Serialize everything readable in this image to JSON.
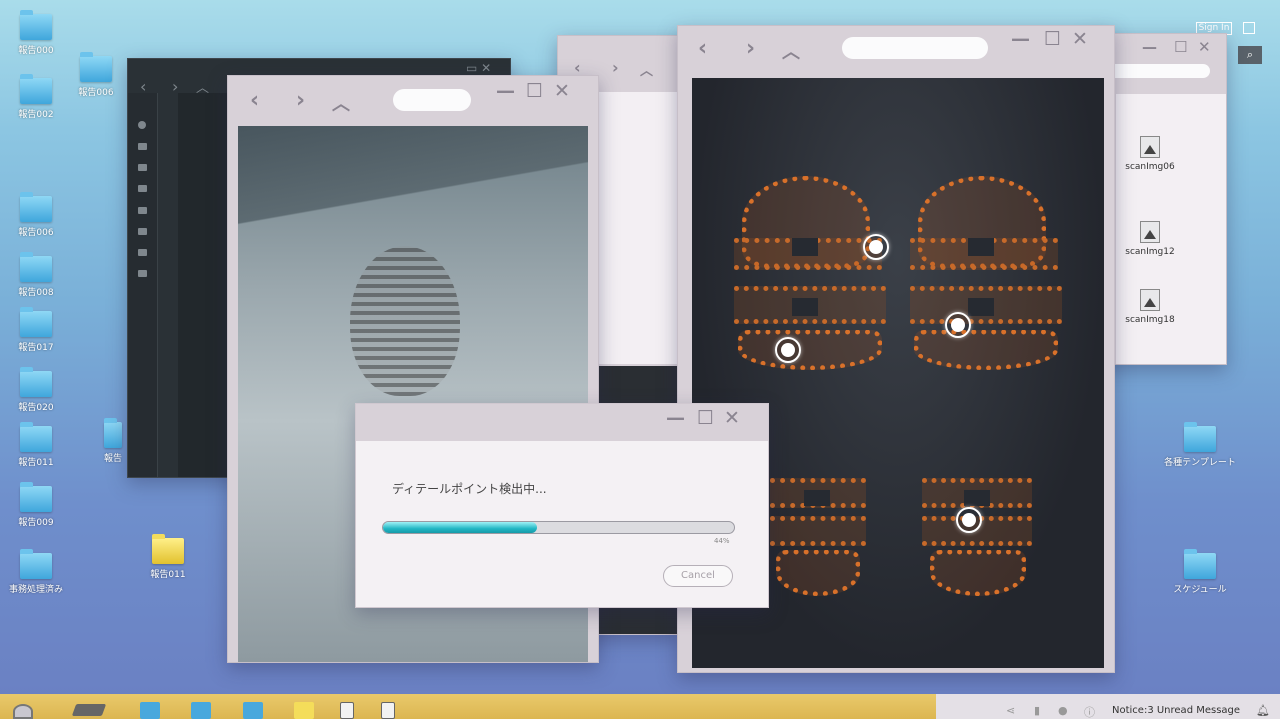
{
  "desktop": {
    "icons": [
      {
        "label": "報告000"
      },
      {
        "label": "報告006"
      },
      {
        "label": "報告002"
      },
      {
        "label": "報告006"
      },
      {
        "label": "報告008"
      },
      {
        "label": "報告017"
      },
      {
        "label": "報告020"
      },
      {
        "label": "報告011"
      },
      {
        "label": "報告009"
      },
      {
        "label": "事務処理済み"
      },
      {
        "label": "報告011"
      },
      {
        "label": "報告"
      },
      {
        "label": "各種テンプレート"
      },
      {
        "label": "スケジュール"
      }
    ]
  },
  "top_bar": {
    "sign_in": "Sign In"
  },
  "file_window": {
    "files": [
      {
        "label": "scanImg06"
      },
      {
        "label": "scanImg12"
      },
      {
        "label": "scanImg18"
      }
    ]
  },
  "dialog": {
    "message": "ディテールポイント検出中...",
    "progress": 0.44,
    "progress_text": "44%",
    "cancel_label": "Cancel"
  },
  "taskbar": {
    "notice": "Notice:3 Unread Message"
  },
  "colors": {
    "progress": "#22b7c4",
    "taskbar": "#e2bf5d",
    "scan_orange": "#d9712a"
  }
}
